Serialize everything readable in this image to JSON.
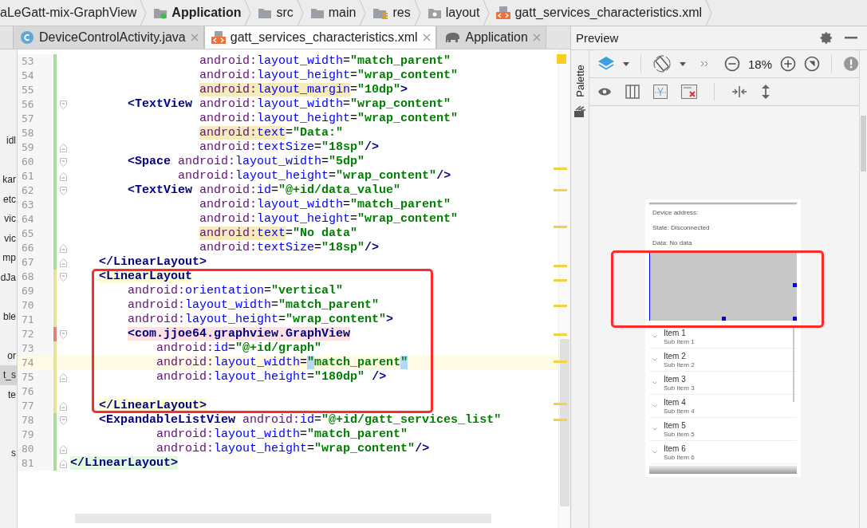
{
  "breadcrumbs": [
    {
      "kind": "project",
      "label": "aLeGatt-mix-GraphView"
    },
    {
      "kind": "module",
      "label": "Application"
    },
    {
      "kind": "folder",
      "label": "src"
    },
    {
      "kind": "folder",
      "label": "main"
    },
    {
      "kind": "resources",
      "label": "res"
    },
    {
      "kind": "package",
      "label": "layout"
    },
    {
      "kind": "xml",
      "label": "gatt_services_characteristics.xml"
    }
  ],
  "editor_tabs": [
    {
      "kind": "java",
      "label": "DeviceControlActivity.java",
      "selected": false
    },
    {
      "kind": "xml",
      "label": "gatt_services_characteristics.xml",
      "selected": true
    },
    {
      "kind": "gradle",
      "label": "Application",
      "selected": false
    }
  ],
  "project_strip": [
    {
      "kind": "gap"
    },
    {
      "kind": "gap"
    },
    {
      "kind": "label",
      "text": "idl",
      "selected": false
    },
    {
      "kind": "gap"
    },
    {
      "kind": "label",
      "text": "kar",
      "selected": false
    },
    {
      "kind": "label",
      "text": "etc",
      "selected": false
    },
    {
      "kind": "label",
      "text": "vic",
      "selected": false
    },
    {
      "kind": "label",
      "text": "vic",
      "selected": false
    },
    {
      "kind": "label",
      "text": "mp",
      "selected": false
    },
    {
      "kind": "label",
      "text": "dJa",
      "selected": false
    },
    {
      "kind": "gap"
    },
    {
      "kind": "label",
      "text": "ble",
      "selected": false
    },
    {
      "kind": "gap"
    },
    {
      "kind": "label",
      "text": "or",
      "selected": false
    },
    {
      "kind": "label",
      "text": "t_s",
      "selected": true
    },
    {
      "kind": "label",
      "text": "te",
      "selected": false
    },
    {
      "kind": "gap"
    },
    {
      "kind": "gap"
    },
    {
      "kind": "label",
      "text": "s",
      "selected": false
    }
  ],
  "editor": {
    "lines": [
      {
        "number": "53",
        "change": {
          "kind": "added"
        },
        "current": false,
        "tokens": [
          {
            "kind": "ns",
            "text": "                  android:"
          },
          {
            "kind": "attr",
            "text": "layout_width"
          },
          {
            "kind": "plain",
            "text": "="
          },
          {
            "kind": "value",
            "text": "\"match_parent\""
          }
        ]
      },
      {
        "number": "54",
        "change": {
          "kind": "added"
        },
        "current": false,
        "tokens": [
          {
            "kind": "ns",
            "text": "                  android:"
          },
          {
            "kind": "attr",
            "text": "layout_height"
          },
          {
            "kind": "plain",
            "text": "="
          },
          {
            "kind": "value",
            "text": "\"wrap_content\""
          }
        ]
      },
      {
        "number": "55",
        "change": {
          "kind": "added"
        },
        "current": false,
        "tokens": [
          {
            "kind": "ns",
            "text": "                  android:",
            "highlight": {
              "kind": "warning"
            }
          },
          {
            "kind": "attr",
            "text": "layout_margin",
            "highlight": {
              "kind": "warning"
            }
          },
          {
            "kind": "plain",
            "text": "="
          },
          {
            "kind": "value",
            "text": "\"10dp\""
          },
          {
            "kind": "tag",
            "text": ">"
          }
        ]
      },
      {
        "number": "56",
        "change": {
          "kind": "added"
        },
        "fold": {
          "kind": "start"
        },
        "current": false,
        "tokens": [
          {
            "kind": "tag",
            "text": "        <TextView "
          },
          {
            "kind": "ns",
            "text": "android:"
          },
          {
            "kind": "attr",
            "text": "layout_width"
          },
          {
            "kind": "plain",
            "text": "="
          },
          {
            "kind": "value",
            "text": "\"wrap_content\""
          }
        ]
      },
      {
        "number": "57",
        "change": {
          "kind": "added"
        },
        "current": false,
        "tokens": [
          {
            "kind": "ns",
            "text": "                  android:"
          },
          {
            "kind": "attr",
            "text": "layout_height"
          },
          {
            "kind": "plain",
            "text": "="
          },
          {
            "kind": "value",
            "text": "\"wrap_content\""
          }
        ]
      },
      {
        "number": "58",
        "change": {
          "kind": "added"
        },
        "current": false,
        "tokens": [
          {
            "kind": "ns",
            "text": "                  android:",
            "highlight": {
              "kind": "warning"
            }
          },
          {
            "kind": "attr",
            "text": "text",
            "highlight": {
              "kind": "warning"
            }
          },
          {
            "kind": "plain",
            "text": "="
          },
          {
            "kind": "value",
            "text": "\"Data:\""
          }
        ]
      },
      {
        "number": "59",
        "change": {
          "kind": "added"
        },
        "fold": {
          "kind": "end"
        },
        "current": false,
        "tokens": [
          {
            "kind": "ns",
            "text": "                  android:"
          },
          {
            "kind": "attr",
            "text": "textSize"
          },
          {
            "kind": "plain",
            "text": "="
          },
          {
            "kind": "value",
            "text": "\"18sp\""
          },
          {
            "kind": "tag",
            "text": "/>"
          }
        ]
      },
      {
        "number": "60",
        "change": {
          "kind": "added"
        },
        "fold": {
          "kind": "start"
        },
        "current": false,
        "tokens": [
          {
            "kind": "tag",
            "text": "        <Space "
          },
          {
            "kind": "ns",
            "text": "android:"
          },
          {
            "kind": "attr",
            "text": "layout_width"
          },
          {
            "kind": "plain",
            "text": "="
          },
          {
            "kind": "value",
            "text": "\"5dp\""
          }
        ]
      },
      {
        "number": "61",
        "change": {
          "kind": "added"
        },
        "fold": {
          "kind": "end"
        },
        "current": false,
        "tokens": [
          {
            "kind": "ns",
            "text": "               android:"
          },
          {
            "kind": "attr",
            "text": "layout_height"
          },
          {
            "kind": "plain",
            "text": "="
          },
          {
            "kind": "value",
            "text": "\"wrap_content\""
          },
          {
            "kind": "tag",
            "text": "/>"
          }
        ]
      },
      {
        "number": "62",
        "change": {
          "kind": "added"
        },
        "fold": {
          "kind": "start"
        },
        "current": false,
        "tokens": [
          {
            "kind": "tag",
            "text": "        <TextView "
          },
          {
            "kind": "ns",
            "text": "android:"
          },
          {
            "kind": "attr",
            "text": "id"
          },
          {
            "kind": "plain",
            "text": "="
          },
          {
            "kind": "value",
            "text": "\"@+id/data_value\""
          }
        ]
      },
      {
        "number": "63",
        "change": {
          "kind": "added"
        },
        "current": false,
        "tokens": [
          {
            "kind": "ns",
            "text": "                  android:"
          },
          {
            "kind": "attr",
            "text": "layout_width"
          },
          {
            "kind": "plain",
            "text": "="
          },
          {
            "kind": "value",
            "text": "\"match_parent\""
          }
        ]
      },
      {
        "number": "64",
        "change": {
          "kind": "added"
        },
        "current": false,
        "tokens": [
          {
            "kind": "ns",
            "text": "                  android:"
          },
          {
            "kind": "attr",
            "text": "layout_height"
          },
          {
            "kind": "plain",
            "text": "="
          },
          {
            "kind": "value",
            "text": "\"wrap_content\""
          }
        ]
      },
      {
        "number": "65",
        "change": {
          "kind": "added"
        },
        "current": false,
        "tokens": [
          {
            "kind": "ns",
            "text": "                  android:",
            "highlight": {
              "kind": "warning"
            }
          },
          {
            "kind": "attr",
            "text": "text",
            "highlight": {
              "kind": "warning"
            }
          },
          {
            "kind": "plain",
            "text": "="
          },
          {
            "kind": "value",
            "text": "\"No data\""
          }
        ]
      },
      {
        "number": "66",
        "change": {
          "kind": "added"
        },
        "fold": {
          "kind": "end"
        },
        "current": false,
        "tokens": [
          {
            "kind": "ns",
            "text": "                  android:"
          },
          {
            "kind": "attr",
            "text": "textSize"
          },
          {
            "kind": "plain",
            "text": "="
          },
          {
            "kind": "value",
            "text": "\"18sp\""
          },
          {
            "kind": "tag",
            "text": "/>"
          }
        ]
      },
      {
        "number": "67",
        "change": {
          "kind": "added"
        },
        "fold": {
          "kind": "end"
        },
        "current": false,
        "tokens": [
          {
            "kind": "tag",
            "text": "    </LinearLayout>"
          }
        ]
      },
      {
        "number": "68",
        "change": {
          "kind": "modified"
        },
        "fold": {
          "kind": "start"
        },
        "current": false,
        "tokens": [
          {
            "kind": "tag",
            "text": "    <LinearLayout",
            "highlight": {
              "kind": "match"
            }
          }
        ]
      },
      {
        "number": "69",
        "change": {
          "kind": "modified"
        },
        "current": false,
        "tokens": [
          {
            "kind": "ns",
            "text": "        android:"
          },
          {
            "kind": "attr",
            "text": "orientation"
          },
          {
            "kind": "plain",
            "text": "="
          },
          {
            "kind": "value",
            "text": "\"vertical\""
          }
        ]
      },
      {
        "number": "70",
        "change": {
          "kind": "modified"
        },
        "current": false,
        "tokens": [
          {
            "kind": "ns",
            "text": "        android:"
          },
          {
            "kind": "attr",
            "text": "layout_width"
          },
          {
            "kind": "plain",
            "text": "="
          },
          {
            "kind": "value",
            "text": "\"match_parent\""
          }
        ]
      },
      {
        "number": "71",
        "change": {
          "kind": "modified"
        },
        "current": false,
        "tokens": [
          {
            "kind": "ns",
            "text": "        android:"
          },
          {
            "kind": "attr",
            "text": "layout_height"
          },
          {
            "kind": "plain",
            "text": "="
          },
          {
            "kind": "value",
            "text": "\"wrap_content\""
          },
          {
            "kind": "tag",
            "text": ">"
          }
        ]
      },
      {
        "number": "72",
        "change": {
          "kind": "error"
        },
        "fold": {
          "kind": "start"
        },
        "current": false,
        "tokens": [
          {
            "kind": "tag",
            "text": "        <com.jjoe64.graphview.GraphView",
            "highlight": {
              "kind": "error"
            }
          }
        ]
      },
      {
        "number": "73",
        "change": {
          "kind": "modified"
        },
        "current": false,
        "tokens": [
          {
            "kind": "ns",
            "text": "            android:"
          },
          {
            "kind": "attr",
            "text": "id"
          },
          {
            "kind": "plain",
            "text": "="
          },
          {
            "kind": "value",
            "text": "\"@+id/graph\""
          }
        ]
      },
      {
        "number": "74",
        "change": {
          "kind": "modified"
        },
        "current": true,
        "tokens": [
          {
            "kind": "ns",
            "text": "            android:"
          },
          {
            "kind": "attr",
            "text": "layout_width"
          },
          {
            "kind": "plain",
            "text": "="
          },
          {
            "kind": "value",
            "text": "\"",
            "highlight": {
              "kind": "brace"
            }
          },
          {
            "kind": "value",
            "text": "match_parent"
          },
          {
            "kind": "value",
            "text": "\"",
            "highlight": {
              "kind": "brace"
            }
          }
        ]
      },
      {
        "number": "75",
        "change": {
          "kind": "modified"
        },
        "fold": {
          "kind": "end"
        },
        "current": false,
        "tokens": [
          {
            "kind": "ns",
            "text": "            android:"
          },
          {
            "kind": "attr",
            "text": "layout_height"
          },
          {
            "kind": "plain",
            "text": "="
          },
          {
            "kind": "value",
            "text": "\"180dp\""
          },
          {
            "kind": "tag",
            "text": " />"
          }
        ]
      },
      {
        "number": "76",
        "change": {
          "kind": "modified"
        },
        "current": false
      },
      {
        "number": "77",
        "change": {
          "kind": "modified"
        },
        "fold": {
          "kind": "end"
        },
        "current": false,
        "tokens": [
          {
            "kind": "tag",
            "text": "    </LinearLayout>",
            "highlight": {
              "kind": "match"
            }
          }
        ]
      },
      {
        "number": "78",
        "change": {
          "kind": "added"
        },
        "fold": {
          "kind": "start"
        },
        "current": false,
        "tokens": [
          {
            "kind": "tag",
            "text": "    <ExpandableListView "
          },
          {
            "kind": "ns",
            "text": "android:"
          },
          {
            "kind": "attr",
            "text": "id"
          },
          {
            "kind": "plain",
            "text": "="
          },
          {
            "kind": "value",
            "text": "\"@+id/gatt_services_list\""
          }
        ]
      },
      {
        "number": "79",
        "change": {
          "kind": "added"
        },
        "current": false,
        "tokens": [
          {
            "kind": "ns",
            "text": "            android:"
          },
          {
            "kind": "attr",
            "text": "layout_width"
          },
          {
            "kind": "plain",
            "text": "="
          },
          {
            "kind": "value",
            "text": "\"match_parent\""
          }
        ]
      },
      {
        "number": "80",
        "change": {
          "kind": "added"
        },
        "fold": {
          "kind": "end"
        },
        "current": false,
        "tokens": [
          {
            "kind": "ns",
            "text": "            android:"
          },
          {
            "kind": "attr",
            "text": "layout_height"
          },
          {
            "kind": "plain",
            "text": "="
          },
          {
            "kind": "value",
            "text": "\"wrap_content\""
          },
          {
            "kind": "tag",
            "text": "/>"
          }
        ]
      },
      {
        "number": "81",
        "change": {
          "kind": "added"
        },
        "fold": {
          "kind": "end"
        },
        "current": false,
        "tokens": [
          {
            "kind": "tag",
            "text": "</LinearLayout>",
            "highlight": {
              "kind": "added"
            }
          }
        ]
      }
    ]
  },
  "preview": {
    "title": "Preview",
    "palette_label": "Palette",
    "zoom": "18%",
    "device": {
      "rows": [
        "Device address:",
        "State: Disconnected",
        "Data: No data"
      ],
      "list_items": [
        {
          "title": "Item 1",
          "subtitle": "Sub Item 1"
        },
        {
          "title": "Item 2",
          "subtitle": "Sub Item 2"
        },
        {
          "title": "Item 3",
          "subtitle": "Sub Item 3"
        },
        {
          "title": "Item 4",
          "subtitle": "Sub Item 4"
        },
        {
          "title": "Item 5",
          "subtitle": "Sub Item 5"
        },
        {
          "title": "Item 6",
          "subtitle": "Sub Item 6"
        }
      ]
    }
  }
}
